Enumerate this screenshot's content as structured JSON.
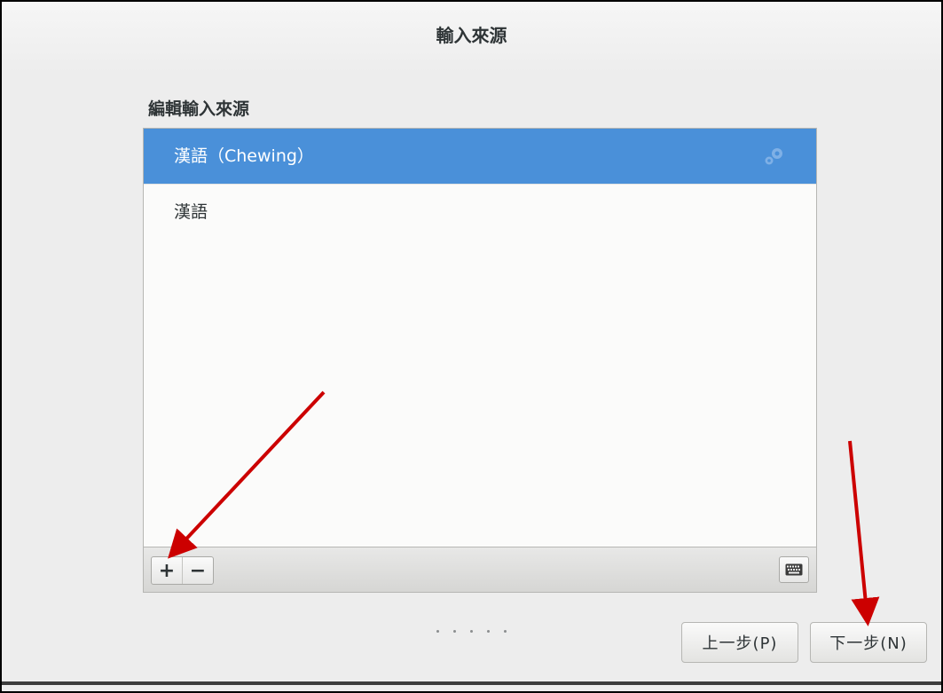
{
  "window": {
    "title": "輸入來源"
  },
  "section": {
    "heading": "編輯輸入來源"
  },
  "input_sources": [
    {
      "label": "漢語（Chewing）",
      "selected": true,
      "settings_icon": "gear-icon"
    },
    {
      "label": "漢語",
      "selected": false
    }
  ],
  "toolbar": {
    "add_label": "+",
    "remove_label": "−",
    "keyboard_icon": "keyboard-icon"
  },
  "navigation": {
    "prev_label": "上一步(P)",
    "next_label": "下一步(N)",
    "page_dots": 5
  },
  "colors": {
    "selection": "#4a90d9",
    "annotation_arrow": "#cc0000"
  }
}
